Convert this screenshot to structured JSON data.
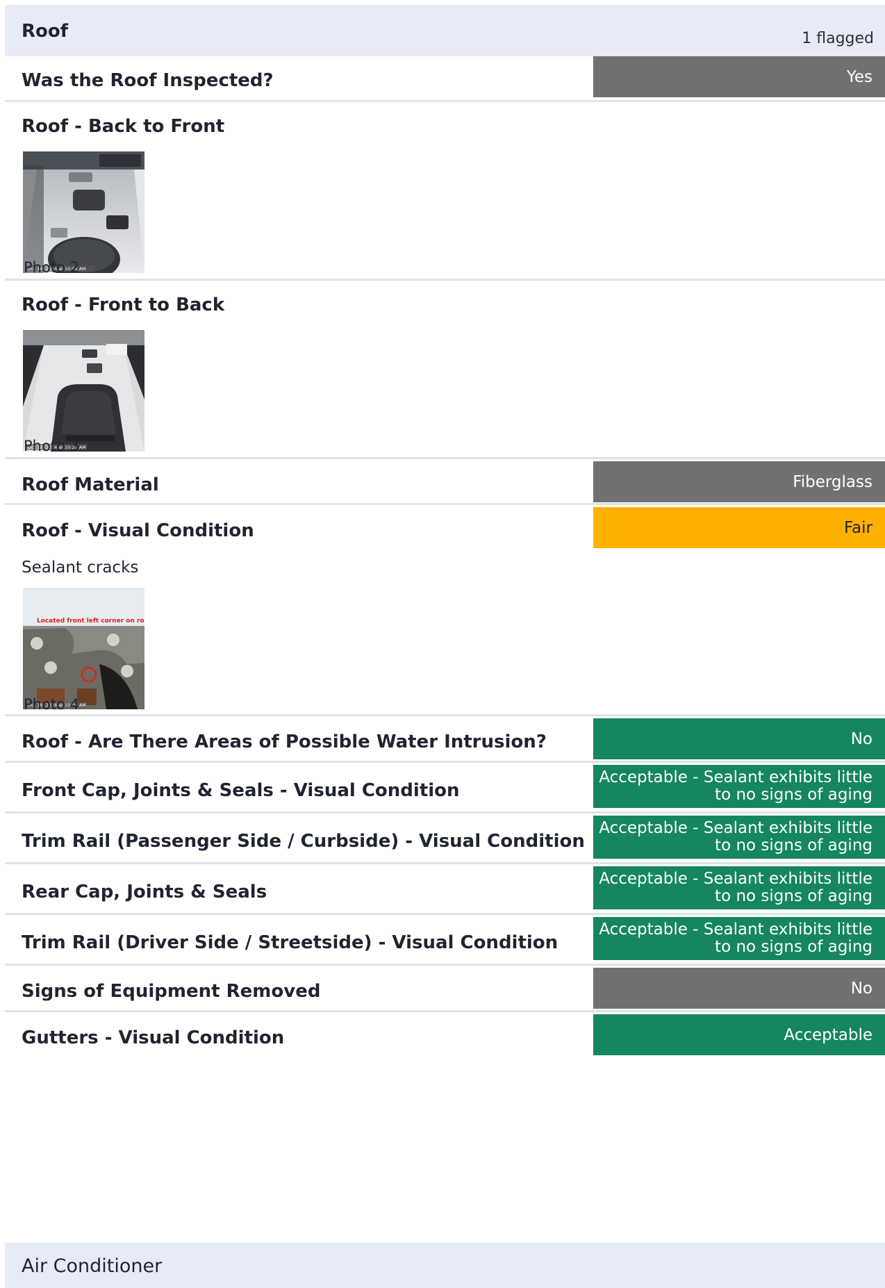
{
  "section": {
    "title": "Roof",
    "flag_count": "1 flagged"
  },
  "rows": [
    {
      "label": "Was the Roof Inspected?",
      "value": "Yes"
    },
    {
      "label": "Roof - Back to Front",
      "photo_caption": "Photo 2",
      "timestamp": "Oct 18, 2024 at 10:05 AM"
    },
    {
      "label": "Roof - Front to Back",
      "photo_caption": "Photo 3",
      "timestamp": "Oct 18, 2024 at 10:21 AM"
    },
    {
      "label": "Roof Material",
      "value": "Fiberglass"
    },
    {
      "label": "Roof - Visual Condition",
      "value": "Fair",
      "note": "Sealant cracks",
      "photo_caption": "Photo 4",
      "photo_text": "Located front left corner on ro",
      "timestamp": "Oct 18, 2024 at 10:06 AM"
    },
    {
      "label": "Roof - Are There Areas of Possible Water Intrusion?",
      "value": "No"
    },
    {
      "label": "Front Cap, Joints & Seals - Visual Condition",
      "value_line1": "Acceptable - Sealant exhibits little",
      "value_line2": "to no signs of aging"
    },
    {
      "label": "Trim Rail (Passenger Side / Curbside) - Visual Condition",
      "value_line1": "Acceptable - Sealant exhibits little",
      "value_line2": "to no signs of aging"
    },
    {
      "label": "Rear Cap, Joints & Seals",
      "value_line1": "Acceptable - Sealant exhibits little",
      "value_line2": "to no signs of aging"
    },
    {
      "label": "Trim Rail (Driver Side / Streetside) - Visual Condition",
      "value_line1": "Acceptable - Sealant exhibits little",
      "value_line2": "to no signs of aging"
    },
    {
      "label": "Signs of Equipment Removed",
      "value": "No"
    },
    {
      "label": "Gutters - Visual Condition",
      "value": "Acceptable"
    }
  ],
  "next_section": {
    "title": "Air Conditioner"
  },
  "colors": {
    "neutral": "#717171",
    "good": "#15865e",
    "warning": "#ffb000",
    "header_bg": "#e6ebf5"
  }
}
